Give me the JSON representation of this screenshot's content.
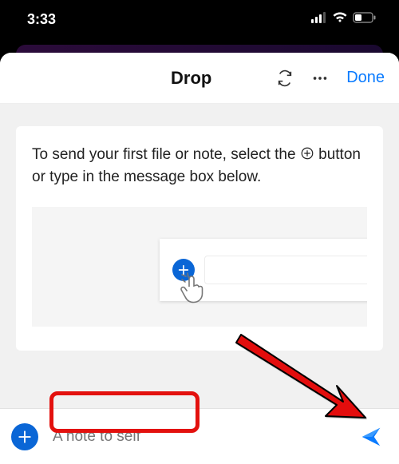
{
  "status": {
    "time": "3:33"
  },
  "header": {
    "title": "Drop",
    "done": "Done"
  },
  "card": {
    "text_before": "To send your first file or note, select the ",
    "text_after": " button or type in the message box below."
  },
  "compose": {
    "placeholder": "A note to self"
  }
}
